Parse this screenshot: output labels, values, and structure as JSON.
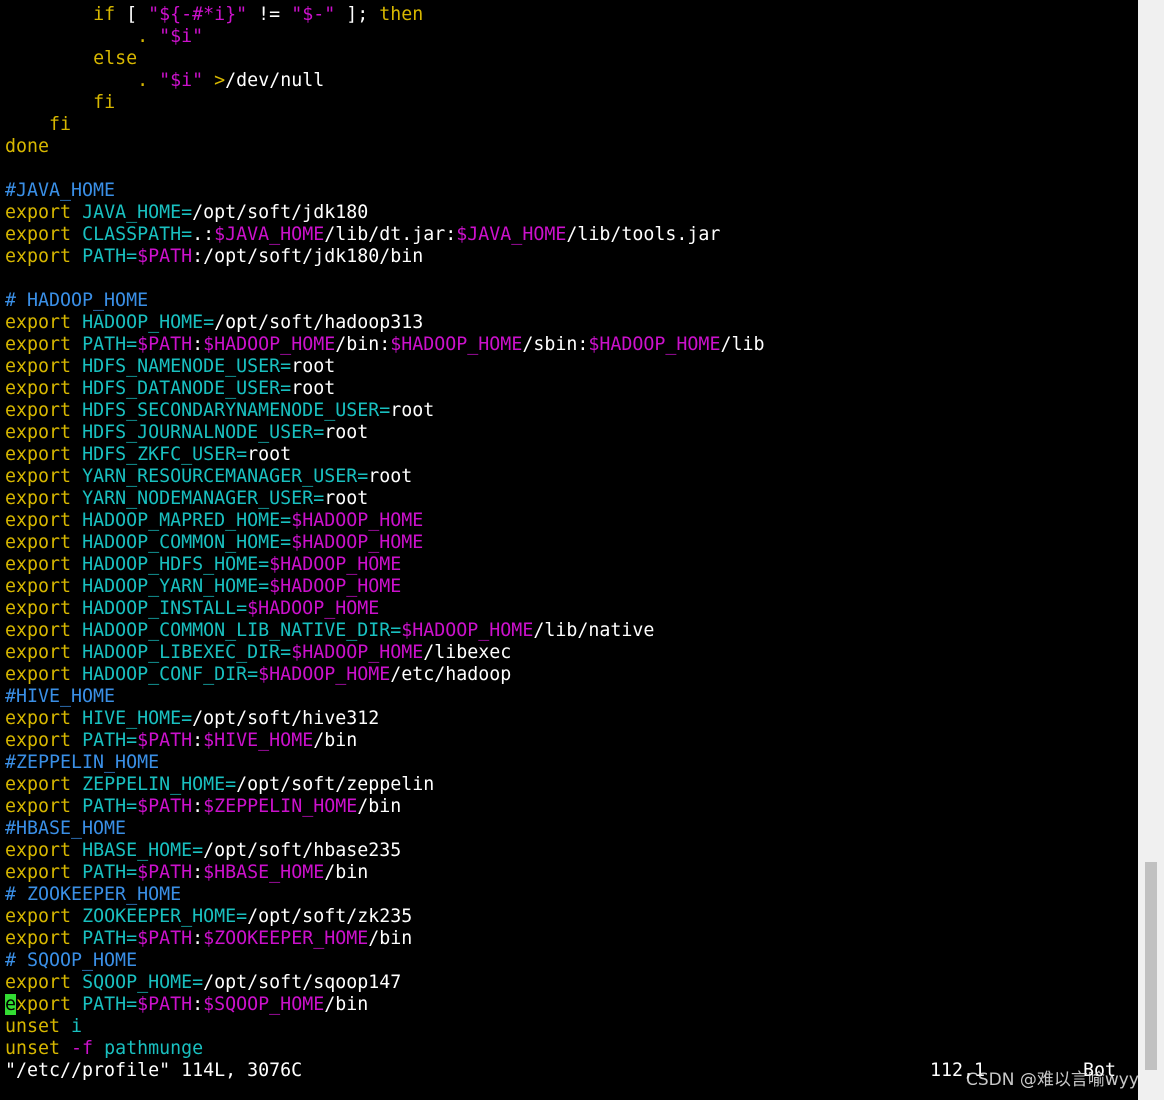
{
  "colors": {
    "background": "#000000",
    "keyword": "#d7b700",
    "comment": "#3a8fe6",
    "identifier": "#19c0c0",
    "variable": "#cc11cc",
    "plain": "#ffffff",
    "cursor": "#33dd33"
  },
  "editor": {
    "lines": [
      [
        {
          "t": "        "
        },
        {
          "t": "if",
          "c": "k"
        },
        {
          "t": " [ ",
          "c": "w"
        },
        {
          "t": "\"${-#*i}\"",
          "c": "m"
        },
        {
          "t": " != ",
          "c": "w"
        },
        {
          "t": "\"$-\"",
          "c": "m"
        },
        {
          "t": " ]; ",
          "c": "w"
        },
        {
          "t": "then",
          "c": "k"
        }
      ],
      [
        {
          "t": "            "
        },
        {
          "t": ".",
          "c": "k"
        },
        {
          "t": " "
        },
        {
          "t": "\"$i\"",
          "c": "m"
        }
      ],
      [
        {
          "t": "        "
        },
        {
          "t": "else",
          "c": "k"
        }
      ],
      [
        {
          "t": "            "
        },
        {
          "t": ".",
          "c": "k"
        },
        {
          "t": " "
        },
        {
          "t": "\"$i\"",
          "c": "m"
        },
        {
          "t": " ",
          "c": "w"
        },
        {
          "t": ">",
          "c": "k"
        },
        {
          "t": "/dev/null",
          "c": "w"
        }
      ],
      [
        {
          "t": "        "
        },
        {
          "t": "fi",
          "c": "k"
        }
      ],
      [
        {
          "t": "    "
        },
        {
          "t": "fi",
          "c": "k"
        }
      ],
      [
        {
          "t": "done",
          "c": "k"
        }
      ],
      [
        {
          "t": ""
        }
      ],
      [
        {
          "t": "#JAVA_HOME",
          "c": "c"
        }
      ],
      [
        {
          "t": "export",
          "c": "k"
        },
        {
          "t": " "
        },
        {
          "t": "JAVA_HOME=",
          "c": "v"
        },
        {
          "t": "/opt/soft/jdk180",
          "c": "w"
        }
      ],
      [
        {
          "t": "export",
          "c": "k"
        },
        {
          "t": " "
        },
        {
          "t": "CLASSPATH=",
          "c": "v"
        },
        {
          "t": ".:",
          "c": "w"
        },
        {
          "t": "$JAVA_HOME",
          "c": "m"
        },
        {
          "t": "/lib/dt.jar:",
          "c": "w"
        },
        {
          "t": "$JAVA_HOME",
          "c": "m"
        },
        {
          "t": "/lib/tools.jar",
          "c": "w"
        }
      ],
      [
        {
          "t": "export",
          "c": "k"
        },
        {
          "t": " "
        },
        {
          "t": "PATH=",
          "c": "v"
        },
        {
          "t": "$PATH",
          "c": "m"
        },
        {
          "t": ":/opt/soft/jdk180/bin",
          "c": "w"
        }
      ],
      [
        {
          "t": ""
        }
      ],
      [
        {
          "t": "# HADOOP_HOME",
          "c": "c"
        }
      ],
      [
        {
          "t": "export",
          "c": "k"
        },
        {
          "t": " "
        },
        {
          "t": "HADOOP_HOME=",
          "c": "v"
        },
        {
          "t": "/opt/soft/hadoop313",
          "c": "w"
        }
      ],
      [
        {
          "t": "export",
          "c": "k"
        },
        {
          "t": " "
        },
        {
          "t": "PATH=",
          "c": "v"
        },
        {
          "t": "$PATH",
          "c": "m"
        },
        {
          "t": ":",
          "c": "w"
        },
        {
          "t": "$HADOOP_HOME",
          "c": "m"
        },
        {
          "t": "/bin:",
          "c": "w"
        },
        {
          "t": "$HADOOP_HOME",
          "c": "m"
        },
        {
          "t": "/sbin:",
          "c": "w"
        },
        {
          "t": "$HADOOP_HOME",
          "c": "m"
        },
        {
          "t": "/lib",
          "c": "w"
        }
      ],
      [
        {
          "t": "export",
          "c": "k"
        },
        {
          "t": " "
        },
        {
          "t": "HDFS_NAMENODE_USER=",
          "c": "v"
        },
        {
          "t": "root",
          "c": "w"
        }
      ],
      [
        {
          "t": "export",
          "c": "k"
        },
        {
          "t": " "
        },
        {
          "t": "HDFS_DATANODE_USER=",
          "c": "v"
        },
        {
          "t": "root",
          "c": "w"
        }
      ],
      [
        {
          "t": "export",
          "c": "k"
        },
        {
          "t": " "
        },
        {
          "t": "HDFS_SECONDARYNAMENODE_USER=",
          "c": "v"
        },
        {
          "t": "root",
          "c": "w"
        }
      ],
      [
        {
          "t": "export",
          "c": "k"
        },
        {
          "t": " "
        },
        {
          "t": "HDFS_JOURNALNODE_USER=",
          "c": "v"
        },
        {
          "t": "root",
          "c": "w"
        }
      ],
      [
        {
          "t": "export",
          "c": "k"
        },
        {
          "t": " "
        },
        {
          "t": "HDFS_ZKFC_USER=",
          "c": "v"
        },
        {
          "t": "root",
          "c": "w"
        }
      ],
      [
        {
          "t": "export",
          "c": "k"
        },
        {
          "t": " "
        },
        {
          "t": "YARN_RESOURCEMANAGER_USER=",
          "c": "v"
        },
        {
          "t": "root",
          "c": "w"
        }
      ],
      [
        {
          "t": "export",
          "c": "k"
        },
        {
          "t": " "
        },
        {
          "t": "YARN_NODEMANAGER_USER=",
          "c": "v"
        },
        {
          "t": "root",
          "c": "w"
        }
      ],
      [
        {
          "t": "export",
          "c": "k"
        },
        {
          "t": " "
        },
        {
          "t": "HADOOP_MAPRED_HOME=",
          "c": "v"
        },
        {
          "t": "$HADOOP_HOME",
          "c": "m"
        }
      ],
      [
        {
          "t": "export",
          "c": "k"
        },
        {
          "t": " "
        },
        {
          "t": "HADOOP_COMMON_HOME=",
          "c": "v"
        },
        {
          "t": "$HADOOP_HOME",
          "c": "m"
        }
      ],
      [
        {
          "t": "export",
          "c": "k"
        },
        {
          "t": " "
        },
        {
          "t": "HADOOP_HDFS_HOME=",
          "c": "v"
        },
        {
          "t": "$HADOOP_HOME",
          "c": "m"
        }
      ],
      [
        {
          "t": "export",
          "c": "k"
        },
        {
          "t": " "
        },
        {
          "t": "HADOOP_YARN_HOME=",
          "c": "v"
        },
        {
          "t": "$HADOOP_HOME",
          "c": "m"
        }
      ],
      [
        {
          "t": "export",
          "c": "k"
        },
        {
          "t": " "
        },
        {
          "t": "HADOOP_INSTALL=",
          "c": "v"
        },
        {
          "t": "$HADOOP_HOME",
          "c": "m"
        }
      ],
      [
        {
          "t": "export",
          "c": "k"
        },
        {
          "t": " "
        },
        {
          "t": "HADOOP_COMMON_LIB_NATIVE_DIR=",
          "c": "v"
        },
        {
          "t": "$HADOOP_HOME",
          "c": "m"
        },
        {
          "t": "/lib/native",
          "c": "w"
        }
      ],
      [
        {
          "t": "export",
          "c": "k"
        },
        {
          "t": " "
        },
        {
          "t": "HADOOP_LIBEXEC_DIR=",
          "c": "v"
        },
        {
          "t": "$HADOOP_HOME",
          "c": "m"
        },
        {
          "t": "/libexec",
          "c": "w"
        }
      ],
      [
        {
          "t": "export",
          "c": "k"
        },
        {
          "t": " "
        },
        {
          "t": "HADOOP_CONF_DIR=",
          "c": "v"
        },
        {
          "t": "$HADOOP_HOME",
          "c": "m"
        },
        {
          "t": "/etc/hadoop",
          "c": "w"
        }
      ],
      [
        {
          "t": "#HIVE_HOME",
          "c": "c"
        }
      ],
      [
        {
          "t": "export",
          "c": "k"
        },
        {
          "t": " "
        },
        {
          "t": "HIVE_HOME=",
          "c": "v"
        },
        {
          "t": "/opt/soft/hive312",
          "c": "w"
        }
      ],
      [
        {
          "t": "export",
          "c": "k"
        },
        {
          "t": " "
        },
        {
          "t": "PATH=",
          "c": "v"
        },
        {
          "t": "$PATH",
          "c": "m"
        },
        {
          "t": ":",
          "c": "w"
        },
        {
          "t": "$HIVE_HOME",
          "c": "m"
        },
        {
          "t": "/bin",
          "c": "w"
        }
      ],
      [
        {
          "t": "#ZEPPELIN_HOME",
          "c": "c"
        }
      ],
      [
        {
          "t": "export",
          "c": "k"
        },
        {
          "t": " "
        },
        {
          "t": "ZEPPELIN_HOME=",
          "c": "v"
        },
        {
          "t": "/opt/soft/zeppelin",
          "c": "w"
        }
      ],
      [
        {
          "t": "export",
          "c": "k"
        },
        {
          "t": " "
        },
        {
          "t": "PATH=",
          "c": "v"
        },
        {
          "t": "$PATH",
          "c": "m"
        },
        {
          "t": ":",
          "c": "w"
        },
        {
          "t": "$ZEPPELIN_HOME",
          "c": "m"
        },
        {
          "t": "/bin",
          "c": "w"
        }
      ],
      [
        {
          "t": "#HBASE_HOME",
          "c": "c"
        }
      ],
      [
        {
          "t": "export",
          "c": "k"
        },
        {
          "t": " "
        },
        {
          "t": "HBASE_HOME=",
          "c": "v"
        },
        {
          "t": "/opt/soft/hbase235",
          "c": "w"
        }
      ],
      [
        {
          "t": "export",
          "c": "k"
        },
        {
          "t": " "
        },
        {
          "t": "PATH=",
          "c": "v"
        },
        {
          "t": "$PATH",
          "c": "m"
        },
        {
          "t": ":",
          "c": "w"
        },
        {
          "t": "$HBASE_HOME",
          "c": "m"
        },
        {
          "t": "/bin",
          "c": "w"
        }
      ],
      [
        {
          "t": "# ZOOKEEPER_HOME",
          "c": "c"
        }
      ],
      [
        {
          "t": "export",
          "c": "k"
        },
        {
          "t": " "
        },
        {
          "t": "ZOOKEEPER_HOME=",
          "c": "v"
        },
        {
          "t": "/opt/soft/zk235",
          "c": "w"
        }
      ],
      [
        {
          "t": "export",
          "c": "k"
        },
        {
          "t": " "
        },
        {
          "t": "PATH=",
          "c": "v"
        },
        {
          "t": "$PATH",
          "c": "m"
        },
        {
          "t": ":",
          "c": "w"
        },
        {
          "t": "$ZOOKEEPER_HOME",
          "c": "m"
        },
        {
          "t": "/bin",
          "c": "w"
        }
      ],
      [
        {
          "t": "# SQOOP_HOME",
          "c": "c"
        }
      ],
      [
        {
          "t": "export",
          "c": "k"
        },
        {
          "t": " "
        },
        {
          "t": "SQOOP_HOME=",
          "c": "v"
        },
        {
          "t": "/opt/soft/sqoop147",
          "c": "w"
        }
      ],
      [
        {
          "t": "e",
          "c": "cursor"
        },
        {
          "t": "xport",
          "c": "k"
        },
        {
          "t": " "
        },
        {
          "t": "PATH=",
          "c": "v"
        },
        {
          "t": "$PATH",
          "c": "m"
        },
        {
          "t": ":",
          "c": "w"
        },
        {
          "t": "$SQOOP_HOME",
          "c": "m"
        },
        {
          "t": "/bin",
          "c": "w"
        }
      ],
      [
        {
          "t": "unset",
          "c": "k"
        },
        {
          "t": " "
        },
        {
          "t": "i",
          "c": "v"
        }
      ],
      [
        {
          "t": "unset",
          "c": "k"
        },
        {
          "t": " "
        },
        {
          "t": "-f",
          "c": "m"
        },
        {
          "t": " "
        },
        {
          "t": "pathmunge",
          "c": "v"
        }
      ]
    ]
  },
  "statusbar": {
    "file_info": "\"/etc//profile\" 114L, 3076C",
    "cursor_position": "112,1",
    "scroll_position": "Bot"
  },
  "watermark": {
    "text": "CSDN @难以言喻wyy"
  }
}
